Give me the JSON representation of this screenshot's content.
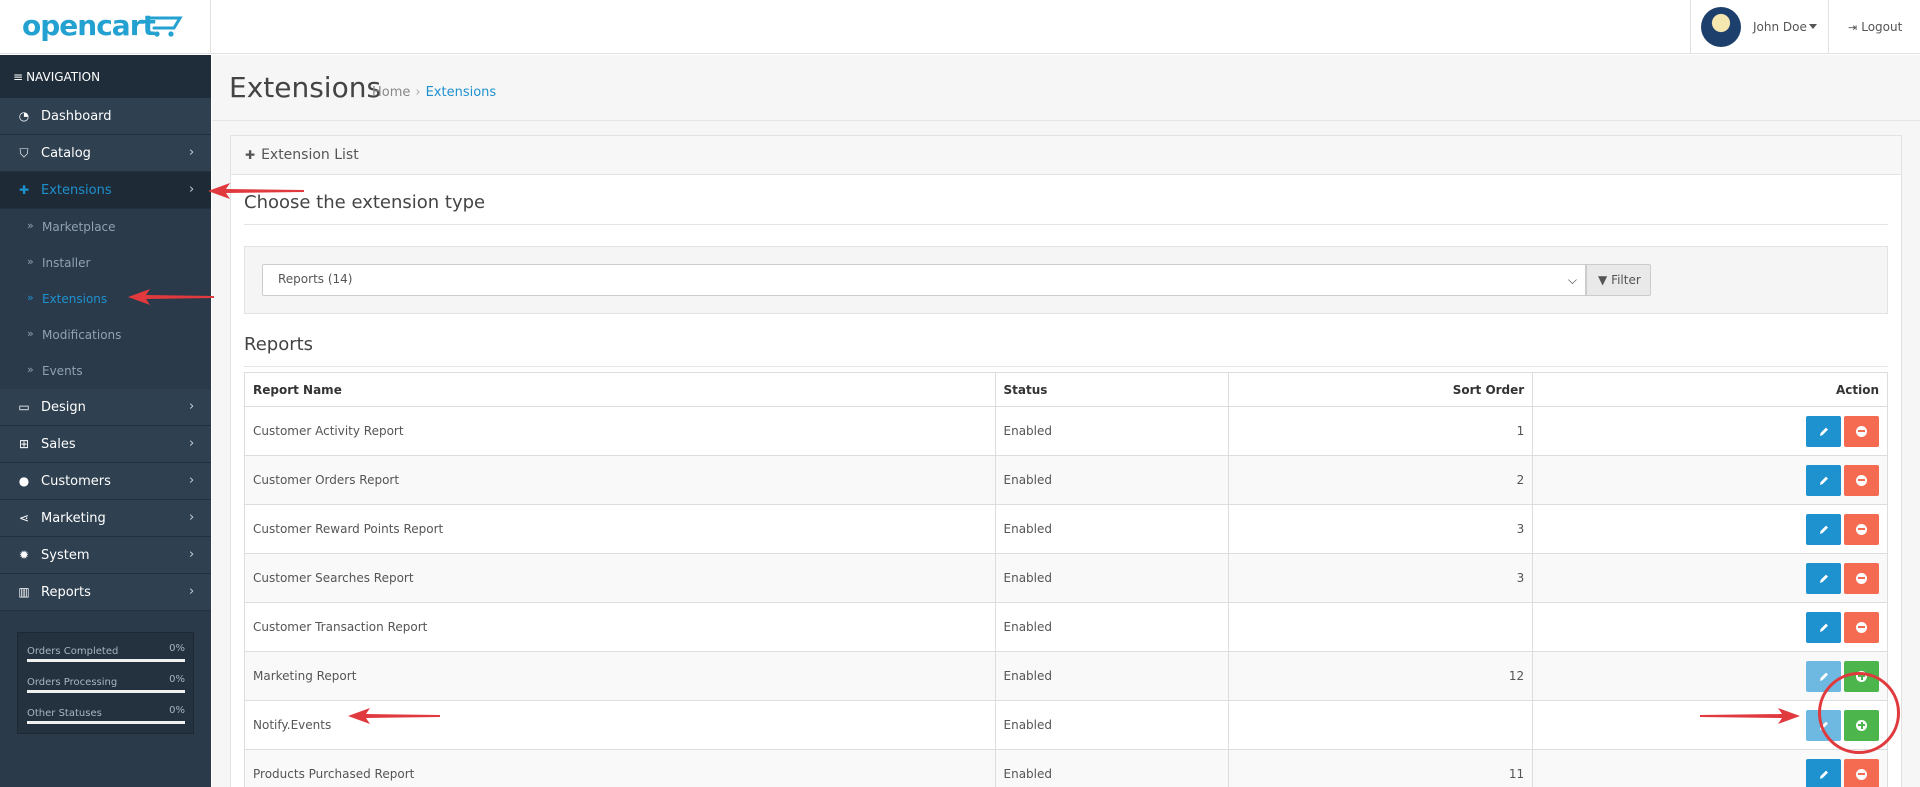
{
  "header": {
    "logo_text": "opencart",
    "user_name": "John Doe",
    "logout_label": "Logout"
  },
  "sidebar": {
    "heading": "NAVIGATION",
    "items": [
      {
        "label": "Dashboard",
        "icon": "dashboard-icon",
        "glyph": "◔"
      },
      {
        "label": "Catalog",
        "icon": "tags-icon",
        "glyph": "⛉"
      },
      {
        "label": "Extensions",
        "icon": "puzzle-icon",
        "glyph": "✚",
        "active": true
      },
      {
        "label": "Design",
        "icon": "monitor-icon",
        "glyph": "▭"
      },
      {
        "label": "Sales",
        "icon": "cart-icon",
        "glyph": "⊞"
      },
      {
        "label": "Customers",
        "icon": "user-icon",
        "glyph": "●"
      },
      {
        "label": "Marketing",
        "icon": "share-icon",
        "glyph": "⋖"
      },
      {
        "label": "System",
        "icon": "gear-icon",
        "glyph": "✹"
      },
      {
        "label": "Reports",
        "icon": "bar-chart-icon",
        "glyph": "▥"
      }
    ],
    "extensions_sub": [
      {
        "label": "Marketplace"
      },
      {
        "label": "Installer"
      },
      {
        "label": "Extensions",
        "active": true
      },
      {
        "label": "Modifications"
      },
      {
        "label": "Events"
      }
    ],
    "stats": [
      {
        "label": "Orders Completed",
        "value": "0%",
        "progress": 0
      },
      {
        "label": "Orders Processing",
        "value": "0%",
        "progress": 0
      },
      {
        "label": "Other Statuses",
        "value": "0%",
        "progress": 0
      }
    ]
  },
  "page": {
    "title": "Extensions",
    "breadcrumb": [
      "Home",
      "Extensions"
    ]
  },
  "panel": {
    "heading": "Extension List",
    "choose_title": "Choose the extension type",
    "type_selected": "Reports (14)",
    "filter_label": "Filter",
    "section_title": "Reports"
  },
  "table": {
    "headers": [
      "Report Name",
      "Status",
      "Sort Order",
      "Action"
    ],
    "rows": [
      {
        "name": "Customer Activity Report",
        "status": "Enabled",
        "sort": "1",
        "installed": true
      },
      {
        "name": "Customer Orders Report",
        "status": "Enabled",
        "sort": "2",
        "installed": true
      },
      {
        "name": "Customer Reward Points Report",
        "status": "Enabled",
        "sort": "3",
        "installed": true
      },
      {
        "name": "Customer Searches Report",
        "status": "Enabled",
        "sort": "3",
        "installed": true
      },
      {
        "name": "Customer Transaction Report",
        "status": "Enabled",
        "sort": "",
        "installed": true
      },
      {
        "name": "Marketing Report",
        "status": "Enabled",
        "sort": "12",
        "installed": false
      },
      {
        "name": "Notify.Events",
        "status": "Enabled",
        "sort": "",
        "installed": false
      },
      {
        "name": "Products Purchased Report",
        "status": "Enabled",
        "sort": "11",
        "installed": true
      }
    ]
  },
  "colors": {
    "accent": "#1e91cf",
    "sidebar": "#2f4050",
    "danger": "#f56b52",
    "success": "#4cb64c",
    "annotation": "#e0393e"
  }
}
